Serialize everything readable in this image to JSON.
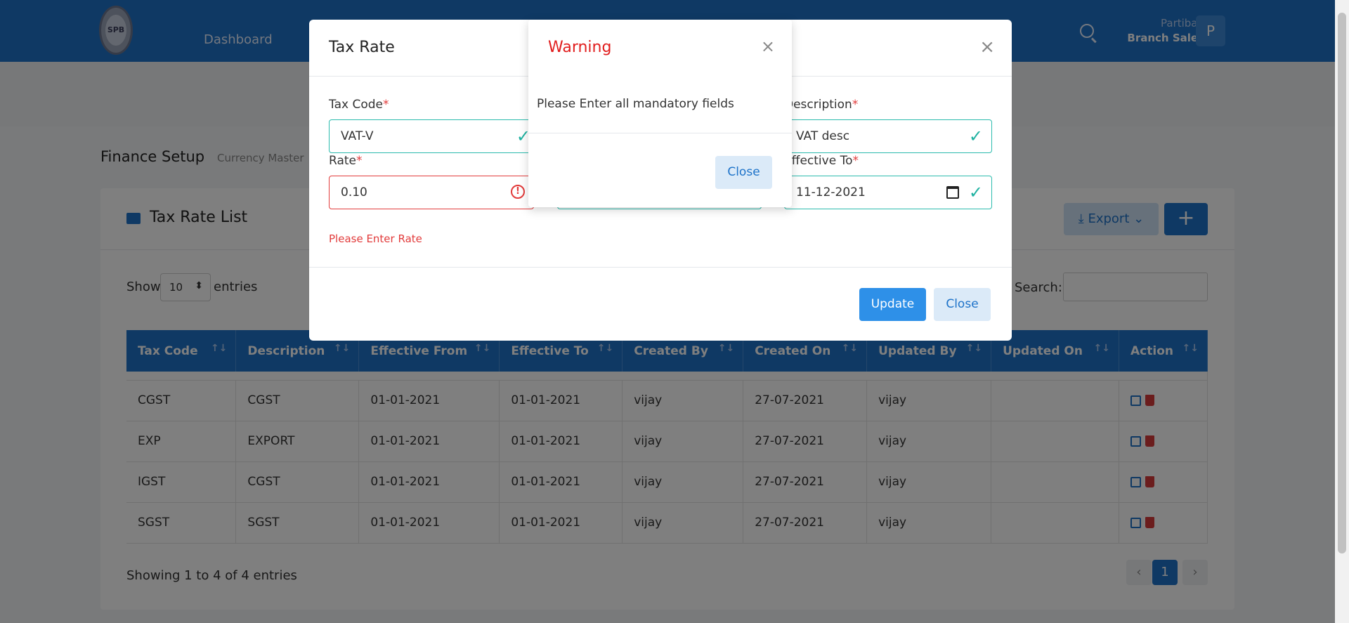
{
  "header": {
    "logo_text": "SPB",
    "nav_dashboard": "Dashboard",
    "user_name": "Partiban",
    "user_role": "Branch Sales",
    "avatar_initial": "P",
    "brand_color": "#1e73c9"
  },
  "breadcrumb": {
    "title": "Finance Setup",
    "sub": "Currency Master"
  },
  "list": {
    "title": "Tax Rate List",
    "export_label": "Export",
    "add_label": "+",
    "show_label": "Show",
    "entries_value": "10",
    "entries_label": "entries",
    "search_label": "Search:",
    "columns": [
      "Tax Code",
      "Description",
      "Effective From",
      "Effective To",
      "Created By",
      "Created On",
      "Updated By",
      "Updated On",
      "Action"
    ],
    "rows": [
      {
        "code": "CGST",
        "desc": "CGST",
        "from": "01-01-2021",
        "to": "01-01-2021",
        "created_by": "vijay",
        "created_on": "27-07-2021",
        "updated_by": "vijay",
        "updated_on": ""
      },
      {
        "code": "EXP",
        "desc": "EXPORT",
        "from": "01-01-2021",
        "to": "01-01-2021",
        "created_by": "vijay",
        "created_on": "27-07-2021",
        "updated_by": "vijay",
        "updated_on": ""
      },
      {
        "code": "IGST",
        "desc": "CGST",
        "from": "01-01-2021",
        "to": "01-01-2021",
        "created_by": "vijay",
        "created_on": "27-07-2021",
        "updated_by": "vijay",
        "updated_on": ""
      },
      {
        "code": "SGST",
        "desc": "SGST",
        "from": "01-01-2021",
        "to": "01-01-2021",
        "created_by": "vijay",
        "created_on": "27-07-2021",
        "updated_by": "vijay",
        "updated_on": ""
      }
    ],
    "showing": "Showing 1 to 4 of 4 entries",
    "current_page": "1"
  },
  "modal": {
    "title": "Tax Rate",
    "tax_code_label": "Tax Code",
    "tax_code_value": "VAT-V",
    "description_label": "Description",
    "description_value": "VAT desc",
    "rate_label": "Rate",
    "rate_value": "0.10",
    "rate_error": "Please Enter Rate",
    "effective_to_label": "Effective To",
    "effective_to_value": "11-12-2021",
    "required_mark": "*",
    "update_label": "Update",
    "close_label": "Close"
  },
  "warning": {
    "title": "Warning",
    "message": "Please Enter all mandatory fields",
    "close_label": "Close",
    "title_color": "#e11d1d"
  }
}
